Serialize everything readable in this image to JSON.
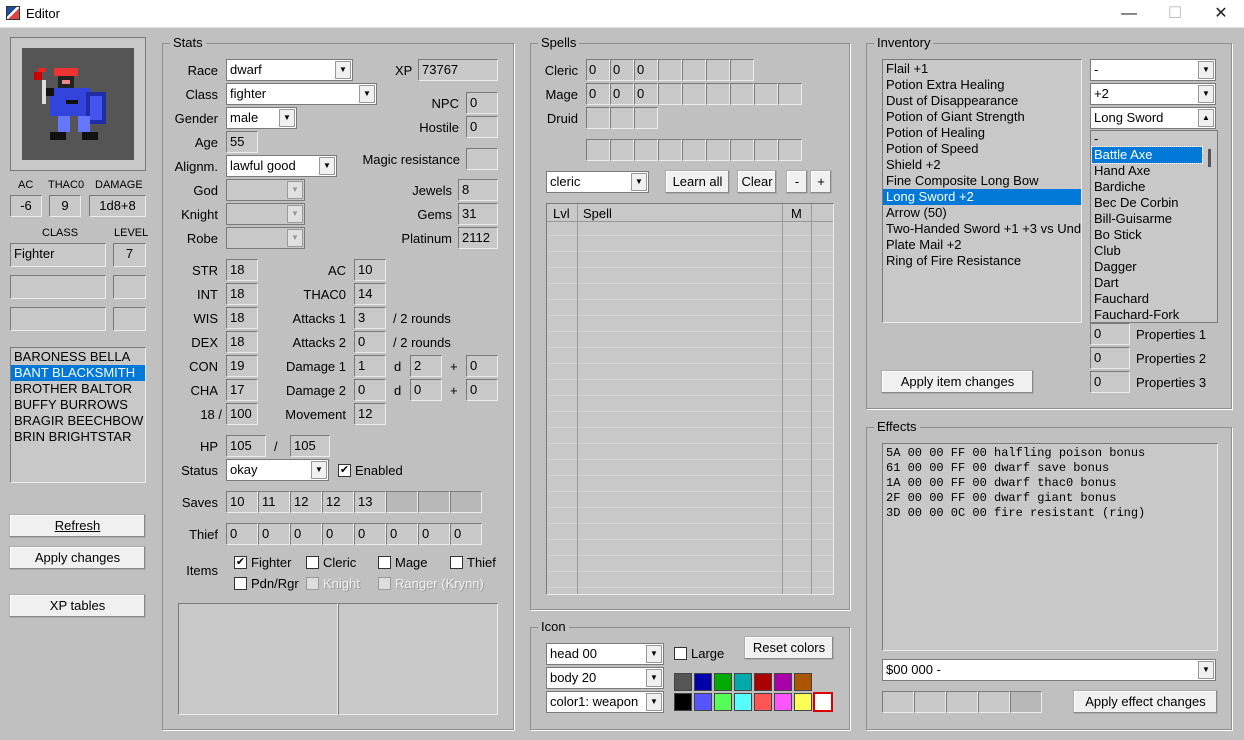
{
  "window": {
    "title": "Editor",
    "min": "—",
    "max": "☐",
    "close": "✕"
  },
  "left": {
    "ac_label": "AC",
    "thac0_label": "THAC0",
    "damage_label": "DAMAGE",
    "ac": "-6",
    "thac0": "9",
    "damage": "1d8+8",
    "class_label": "CLASS",
    "level_label": "LEVEL",
    "class": "Fighter",
    "level": "7",
    "characters": [
      "BARONESS BELLA",
      "BANT BLACKSMITH",
      "BROTHER BALTOR",
      "BUFFY BURROWS",
      "BRAGIR BEECHBOW",
      "BRIN BRIGHTSTAR"
    ],
    "refresh": "Refresh",
    "apply": "Apply changes",
    "xp_tables": "XP tables"
  },
  "stats": {
    "group": "Stats",
    "race_label": "Race",
    "race": "dwarf",
    "class_label": "Class",
    "class": "fighter",
    "gender_label": "Gender",
    "gender": "male",
    "age_label": "Age",
    "age": "55",
    "align_label": "Alignm.",
    "align": "lawful good",
    "god_label": "God",
    "knight_label": "Knight",
    "robe_label": "Robe",
    "xp_label": "XP",
    "xp": "73767",
    "npc_label": "NPC",
    "npc": "0",
    "hostile_label": "Hostile",
    "hostile": "0",
    "mr_label": "Magic resistance",
    "mr": "",
    "jewels_label": "Jewels",
    "jewels": "8",
    "gems_label": "Gems",
    "gems": "31",
    "platinum_label": "Platinum",
    "platinum": "2112",
    "str_label": "STR",
    "str": "18",
    "int_label": "INT",
    "int": "18",
    "wis_label": "WIS",
    "wis": "18",
    "dex_label": "DEX",
    "dex": "18",
    "con_label": "CON",
    "con": "19",
    "cha_label": "CHA",
    "cha": "17",
    "exstr_label": "18 /",
    "exstr": "100",
    "ac_label": "AC",
    "ac": "10",
    "thac0_label": "THAC0",
    "thac0": "14",
    "att1_label": "Attacks 1",
    "att1": "3",
    "att1_suffix": "/ 2 rounds",
    "att2_label": "Attacks 2",
    "att2": "0",
    "att2_suffix": "/ 2 rounds",
    "dmg1_label": "Damage 1",
    "dmg1_a": "1",
    "dmg1_d": "d",
    "dmg1_b": "2",
    "dmg1_p": "+",
    "dmg1_c": "0",
    "dmg2_label": "Damage 2",
    "dmg2_a": "0",
    "dmg2_d": "d",
    "dmg2_b": "0",
    "dmg2_p": "+",
    "dmg2_c": "0",
    "move_label": "Movement",
    "move": "12",
    "hp_label": "HP",
    "hp": "105",
    "hp_sep": "/",
    "hp_max": "105",
    "status_label": "Status",
    "status": "okay",
    "enabled_label": "Enabled",
    "saves_label": "Saves",
    "saves": [
      "10",
      "11",
      "12",
      "12",
      "13",
      "",
      "",
      ""
    ],
    "thief_label": "Thief",
    "thief": [
      "0",
      "0",
      "0",
      "0",
      "0",
      "0",
      "0",
      "0"
    ],
    "items_label": "Items",
    "item_fighter": "Fighter",
    "item_cleric": "Cleric",
    "item_mage": "Mage",
    "item_thief": "Thief",
    "item_pdn": "Pdn/Rgr",
    "item_knight": "Knight",
    "item_ranger": "Ranger (Krynn)"
  },
  "spells": {
    "group": "Spells",
    "cleric_label": "Cleric",
    "cleric": [
      "0",
      "0",
      "0"
    ],
    "mage_label": "Mage",
    "mage": [
      "0",
      "0",
      "0"
    ],
    "druid_label": "Druid",
    "class_select": "cleric",
    "learn_all": "Learn all",
    "clear": "Clear",
    "minus": "-",
    "plus": "+",
    "col_lvl": "Lvl",
    "col_spell": "Spell",
    "col_m": "M"
  },
  "icon": {
    "group": "Icon",
    "head": "head 00",
    "body": "body 20",
    "color": "color1: weapon",
    "large_label": "Large",
    "reset": "Reset colors",
    "palette_top": [
      "#555555",
      "#0000aa",
      "#00aa00",
      "#00aaaa",
      "#aa0000",
      "#aa00aa",
      "#aa5500"
    ],
    "palette_bottom": [
      "#000000",
      "#5555ff",
      "#55ff55",
      "#55ffff",
      "#ff5555",
      "#ff55ff",
      "#ffff55",
      "#ffffff"
    ]
  },
  "inventory": {
    "group": "Inventory",
    "items": [
      "Flail +1",
      "Potion Extra Healing",
      "Dust of Disappearance",
      "Potion of Giant Strength",
      "Potion of Healing",
      "Potion of Speed",
      "Shield +2",
      "Fine Composite Long Bow",
      "Long Sword +2",
      "Arrow (50)",
      "Two-Handed Sword +1 +3 vs Und",
      "Plate Mail +2",
      "Ring of Fire Resistance"
    ],
    "select1": "-",
    "select2": "+2",
    "select3": "Long Sword",
    "types": [
      "-",
      "Battle Axe",
      "Hand Axe",
      "Bardiche",
      "Bec De Corbin",
      "Bill-Guisarme",
      "Bo Stick",
      "Club",
      "Dagger",
      "Dart",
      "Fauchard",
      "Fauchard-Fork"
    ],
    "prop1": "0",
    "prop1_label": "Properties 1",
    "prop2": "0",
    "prop2_label": "Properties 2",
    "prop3": "0",
    "prop3_label": "Properties 3",
    "apply": "Apply item changes"
  },
  "effects": {
    "group": "Effects",
    "lines": [
      "5A 00 00 FF 00   halfling poison bonus",
      "61 00 00 FF 00   dwarf save bonus",
      "1A 00 00 FF 00   dwarf thac0 bonus",
      "2F 00 00 FF 00   dwarf giant bonus",
      "3D 00 00 0C 00   fire resistant (ring)"
    ],
    "select": "$00  000  -",
    "apply": "Apply effect changes"
  }
}
